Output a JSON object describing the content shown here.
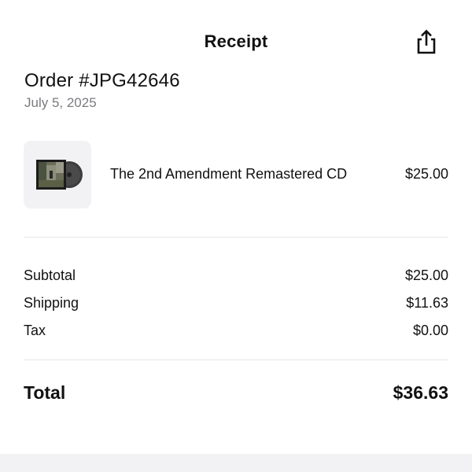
{
  "header": {
    "title": "Receipt",
    "share_icon": "share-icon"
  },
  "order": {
    "title": "Order #JPG42646",
    "date": "July 5, 2025"
  },
  "items": [
    {
      "name": "The 2nd Amendment Remastered CD",
      "price": "$25.00",
      "thumbnail_icon": "album-cover-cd-icon"
    }
  ],
  "summary": {
    "subtotal_label": "Subtotal",
    "subtotal_value": "$25.00",
    "shipping_label": "Shipping",
    "shipping_value": "$11.63",
    "tax_label": "Tax",
    "tax_value": "$0.00"
  },
  "total": {
    "label": "Total",
    "value": "$36.63"
  },
  "colors": {
    "text": "#111111",
    "secondary_text": "#7b7b80",
    "divider": "#e6e6e8",
    "thumb_bg": "#f2f2f4"
  }
}
